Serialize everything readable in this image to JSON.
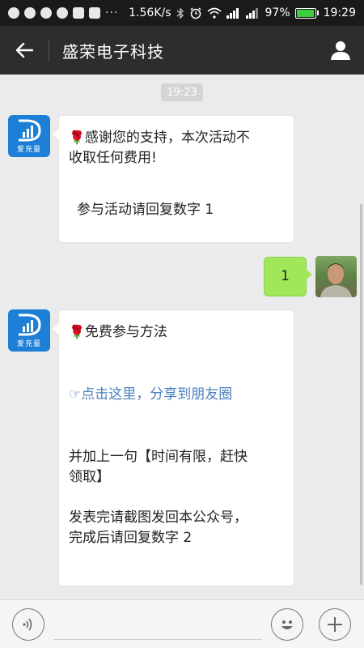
{
  "status_bar": {
    "speed": "1.56K/s",
    "battery": "97%",
    "battery_level": 0.97,
    "time": "19:29",
    "overflow": "···",
    "app_icons": [
      "wechat-icon",
      "qq-icon",
      "weibo-icon",
      "q-icon",
      "message-icon",
      "letv-icon"
    ]
  },
  "header": {
    "title": "盛荣电子科技"
  },
  "chat": {
    "timestamp": "19:23",
    "bot_avatar_caption": "爱充量",
    "messages": [
      {
        "from": "bot",
        "lines": [
          "感谢您的支持，本次活动不",
          "收取任何费用!",
          "",
          "参与活动请回复数字 1"
        ]
      },
      {
        "from": "user",
        "text": "1"
      },
      {
        "from": "bot",
        "title": "免费参与方法",
        "link_prefix": "☞",
        "link_text": "点击这里，分享到朋友圈",
        "body_lines": [
          "并加上一句【时间有限，赶快",
          "领取】",
          "",
          "发表完请截图发回本公众号，",
          "完成后请回复数字 2"
        ]
      }
    ]
  },
  "colors": {
    "header_bg": "#2d2d2d",
    "chat_bg": "#ebebeb",
    "user_bubble": "#a0e75a",
    "link": "#4a7fbe",
    "bot_avatar": "#1e7fd6"
  }
}
